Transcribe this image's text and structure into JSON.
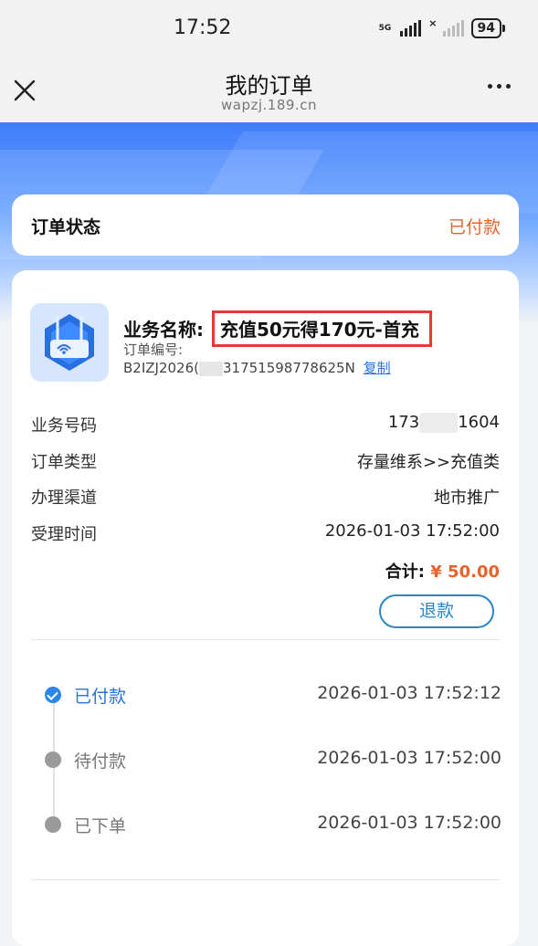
{
  "status_bar": {
    "time": "17:52",
    "network": "5G",
    "battery": "94"
  },
  "header": {
    "title": "我的订单",
    "subtitle": "wapzj.189.cn"
  },
  "order_status": {
    "label": "订单状态",
    "value": "已付款"
  },
  "order": {
    "biz_name_label": "业务名称:",
    "biz_name": "充值50元得170元-首充",
    "order_no_label": "订单编号:",
    "order_no_prefix": "B2IZJ2026(",
    "order_no_suffix": "31751598778625N",
    "copy_label": "复制",
    "details": [
      {
        "key": "业务号码",
        "value_prefix": "173",
        "value_suffix": "1604"
      },
      {
        "key": "订单类型",
        "value": "存量维系>>充值类"
      },
      {
        "key": "办理渠道",
        "value": "地市推广"
      },
      {
        "key": "受理时间",
        "value": "2026-01-03 17:52:00"
      }
    ],
    "total_label": "合计:",
    "total_amount": "¥ 50.00",
    "refund_label": "退款"
  },
  "timeline": [
    {
      "label": "已付款",
      "time": "2026-01-03 17:52:12",
      "done": true
    },
    {
      "label": "待付款",
      "time": "2026-01-03 17:52:00",
      "done": false
    },
    {
      "label": "已下单",
      "time": "2026-01-03 17:52:00",
      "done": false
    }
  ],
  "colors": {
    "accent_blue": "#2a86e8",
    "price_orange": "#e8632b",
    "highlight_red": "#e53935"
  }
}
